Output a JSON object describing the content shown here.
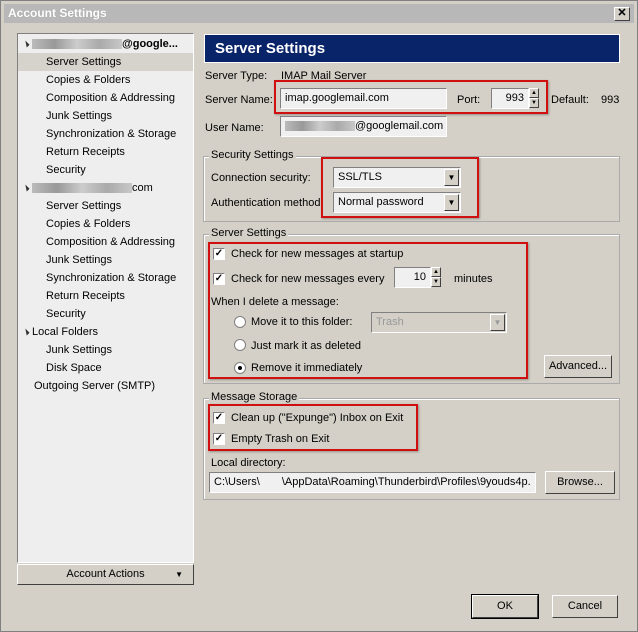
{
  "window": {
    "title": "Account Settings",
    "close_glyph": "✕"
  },
  "tree": {
    "items": [
      {
        "label": "@google...",
        "level": 0,
        "expanded": true,
        "redacted": true
      },
      {
        "label": "Server Settings",
        "level": 1,
        "selected": true
      },
      {
        "label": "Copies & Folders",
        "level": 1
      },
      {
        "label": "Composition & Addressing",
        "level": 1
      },
      {
        "label": "Junk Settings",
        "level": 1
      },
      {
        "label": "Synchronization & Storage",
        "level": 1
      },
      {
        "label": "Return Receipts",
        "level": 1
      },
      {
        "label": "Security",
        "level": 1
      },
      {
        "label": "com",
        "level": 0,
        "expanded": true,
        "redacted": true
      },
      {
        "label": "Server Settings",
        "level": 1
      },
      {
        "label": "Copies & Folders",
        "level": 1
      },
      {
        "label": "Composition & Addressing",
        "level": 1
      },
      {
        "label": "Junk Settings",
        "level": 1
      },
      {
        "label": "Synchronization & Storage",
        "level": 1
      },
      {
        "label": "Return Receipts",
        "level": 1
      },
      {
        "label": "Security",
        "level": 1
      },
      {
        "label": "Local Folders",
        "level": 0,
        "expanded": true
      },
      {
        "label": "Junk Settings",
        "level": 1
      },
      {
        "label": "Disk Space",
        "level": 1
      },
      {
        "label": "Outgoing Server (SMTP)",
        "level": 0
      }
    ],
    "account_actions": "Account Actions"
  },
  "panel": {
    "title": "Server Settings",
    "server_type_label": "Server Type:",
    "server_type_value": "IMAP Mail Server",
    "server_name_label": "Server Name:",
    "server_name_value": "imap.googlemail.com",
    "port_label": "Port:",
    "port_value": "993",
    "default_label": "Default:",
    "default_value": "993",
    "user_name_label": "User Name:",
    "user_name_value": "@googlemail.com",
    "security": {
      "legend": "Security Settings",
      "conn_label": "Connection security:",
      "conn_value": "SSL/TLS",
      "auth_label": "Authentication method:",
      "auth_value": "Normal password"
    },
    "server": {
      "legend": "Server Settings",
      "check_startup": "Check for new messages at startup",
      "check_startup_checked": true,
      "check_every": "Check for new messages every",
      "check_every_checked": true,
      "minutes_value": "10",
      "minutes_label": "minutes",
      "delete_label": "When I delete a message:",
      "move_label": "Move it to this folder:",
      "move_folder": "Trash",
      "mark_label": "Just mark it as deleted",
      "remove_label": "Remove it immediately",
      "selected_option": "remove",
      "advanced": "Advanced..."
    },
    "storage": {
      "legend": "Message Storage",
      "expunge": "Clean up (\"Expunge\") Inbox on Exit",
      "empty_trash": "Empty Trash on Exit",
      "local_dir_label": "Local directory:",
      "local_dir_value": "C:\\Users\\  \\AppData\\Roaming\\Thunderbird\\Profiles\\9youds4p.",
      "browse": "Browse..."
    }
  },
  "buttons": {
    "ok": "OK",
    "cancel": "Cancel"
  },
  "colors": {
    "header_bg": "#0a246a",
    "highlight": "#d01010",
    "dialog_bg": "#d4d0c8"
  }
}
